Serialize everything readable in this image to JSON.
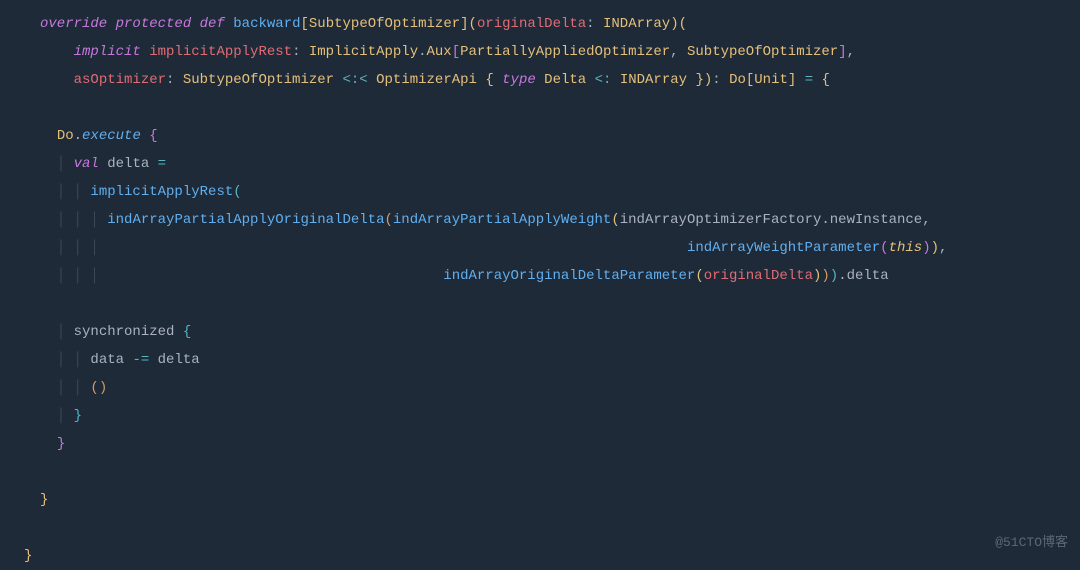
{
  "code": {
    "l1": {
      "kw_override": "override",
      "kw_protected": "protected",
      "kw_def": "def",
      "fn": "backward",
      "tparam": "SubtypeOfOptimizer",
      "param": "originalDelta",
      "ptype": "INDArray"
    },
    "l2": {
      "kw_implicit": "implicit",
      "param": "implicitApplyRest",
      "t1": "ImplicitApply",
      "t2": "Aux",
      "t3": "PartiallyAppliedOptimizer",
      "t4": "SubtypeOfOptimizer"
    },
    "l3": {
      "param": "asOptimizer",
      "t1": "SubtypeOfOptimizer",
      "op": "<:<",
      "t2": "OptimizerApi",
      "kw_type": "type",
      "t3": "Delta",
      "t4": "INDArray",
      "ret1": "Do",
      "ret2": "Unit"
    },
    "l5": {
      "obj": "Do",
      "method": "execute"
    },
    "l6": {
      "kw_val": "val",
      "name": "delta"
    },
    "l7": {
      "call": "implicitApplyRest"
    },
    "l8": {
      "c1": "indArrayPartialApplyOriginalDelta",
      "c2": "indArrayPartialApplyWeight",
      "obj": "indArrayOptimizerFactory",
      "m": "newInstance"
    },
    "l9": {
      "c": "indArrayWeightParameter",
      "this": "this"
    },
    "l10": {
      "c": "indArrayOriginalDeltaParameter",
      "arg": "originalDelta",
      "prop": "delta"
    },
    "l12": {
      "kw": "synchronized"
    },
    "l13": {
      "lhs": "data",
      "op": "-=",
      "rhs": "delta"
    }
  },
  "watermark": "@51CTO博客"
}
